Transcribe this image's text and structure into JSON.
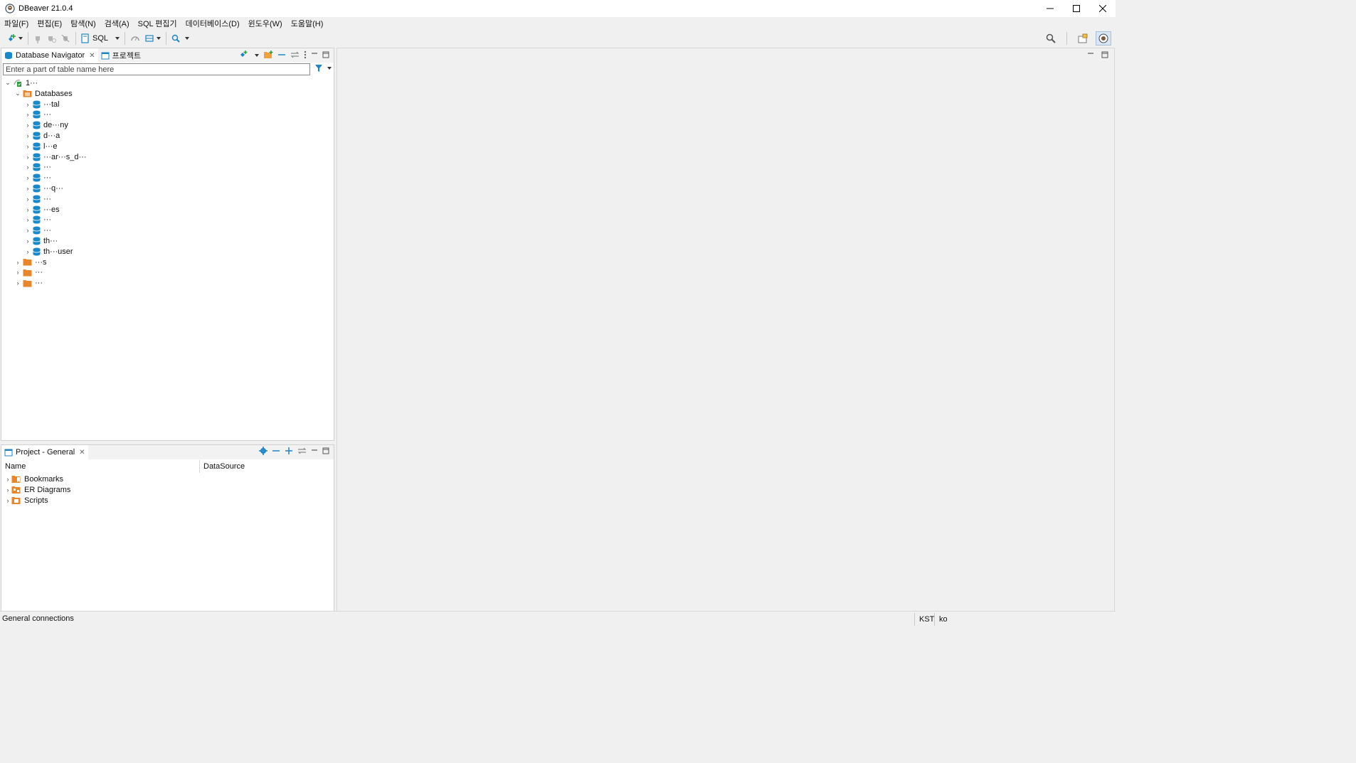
{
  "window": {
    "title": "DBeaver 21.0.4",
    "controls": [
      "minimize-icon",
      "maximize-icon",
      "close-icon"
    ]
  },
  "menu": {
    "items": [
      "파일(F)",
      "편집(E)",
      "탐색(N)",
      "검색(A)",
      "SQL 편집기",
      "데이터베이스(D)",
      "윈도우(W)",
      "도움말(H)"
    ]
  },
  "toolbar": {
    "sql_label": "SQL"
  },
  "navigator": {
    "tabs": [
      {
        "label": "Database Navigator",
        "icon": "database-navigator-icon",
        "active": true
      },
      {
        "label": "프로젝트",
        "icon": "project-icon",
        "active": false
      }
    ],
    "filter_placeholder": "Enter a part of table name here",
    "tree": {
      "connection_label": "1···",
      "databases_label": "Databases",
      "databases": [
        "···tal",
        "···",
        "de···ny",
        "d···a",
        "l···e",
        "···ar···s_d···",
        "···",
        "···",
        "···q···",
        "···",
        "···es",
        "···",
        "···",
        "th···",
        "th···user"
      ],
      "other_nodes": [
        "···s",
        "···",
        "···"
      ]
    }
  },
  "project_panel": {
    "tab_label": "Project - General",
    "columns": [
      "Name",
      "DataSource"
    ],
    "items": [
      {
        "label": "Bookmarks",
        "icon": "bookmarks-folder-icon"
      },
      {
        "label": "ER Diagrams",
        "icon": "er-diagrams-folder-icon"
      },
      {
        "label": "Scripts",
        "icon": "scripts-folder-icon"
      }
    ]
  },
  "status": {
    "left_text": "General connections",
    "timezone": "KST",
    "locale": "ko"
  },
  "colors": {
    "accent_blue": "#1f84c6",
    "folder_orange": "#e8862b",
    "db_blue": "#1a88c9"
  }
}
